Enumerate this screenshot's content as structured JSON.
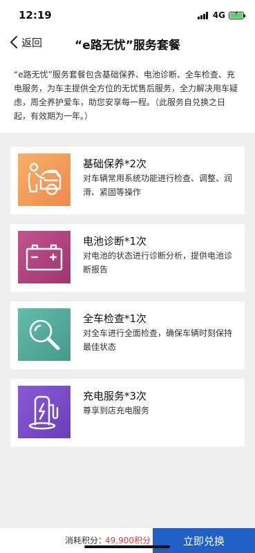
{
  "status_bar": {
    "time": "12:19",
    "network": "4G"
  },
  "nav": {
    "back_label": "返回",
    "title": "“e路无忧”服务套餐"
  },
  "intro_text": "“e路无忧”服务套餐包含基础保养、电池诊断、全车检查、充电服务，为车主提供全方位的无忧售后服务，全力解决用车疑虑，周全养护爱车，助您安享每一程。（此服务自兑换之日起，有效期为一年。）",
  "services": [
    {
      "title": "基础保养*2次",
      "desc": "对车辆常用系统功能进行检查、调整、润滑、紧固等操作",
      "icon": "car-mechanic-icon",
      "color": "#f29b55"
    },
    {
      "title": "电池诊断*1次",
      "desc": "对电池的状态进行诊断分析，提供电池诊断报告",
      "icon": "battery-icon",
      "color": "#b0417e"
    },
    {
      "title": "全车检查*1次",
      "desc": "对全车进行全面检查，确保车辆时刻保持最佳状态",
      "icon": "magnifier-icon",
      "color": "#55ad9e"
    },
    {
      "title": "充电服务*3次",
      "desc": "尊享到店充电服务",
      "icon": "charging-station-icon",
      "color": "#7b4fc6"
    }
  ],
  "footer": {
    "points_label": "消耗积分：",
    "points_value": "49,900积分",
    "redeem_label": "立即兑换"
  },
  "colors": {
    "accent": "#1f5fc6",
    "points": "#e0393e"
  }
}
